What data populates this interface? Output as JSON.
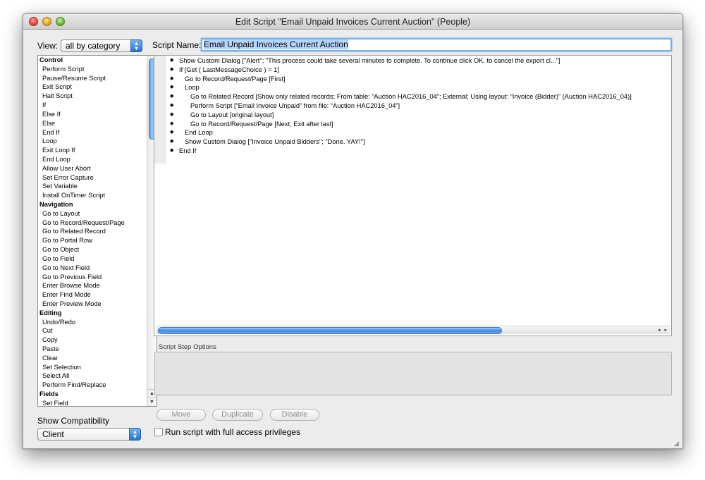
{
  "window": {
    "title": "Edit Script \"Email Unpaid Invoices Current Auction\" (People)"
  },
  "view": {
    "label": "View:",
    "selected": "all by category"
  },
  "script_name": {
    "label": "Script Name:",
    "value": "Email Unpaid Invoices Current Auction"
  },
  "steps": [
    {
      "label": "Control",
      "category": true
    },
    {
      "label": "Perform Script"
    },
    {
      "label": "Pause/Resume Script"
    },
    {
      "label": "Exit Script"
    },
    {
      "label": "Halt Script"
    },
    {
      "label": "If"
    },
    {
      "label": "Else If"
    },
    {
      "label": "Else"
    },
    {
      "label": "End If"
    },
    {
      "label": "Loop"
    },
    {
      "label": "Exit Loop If"
    },
    {
      "label": "End Loop"
    },
    {
      "label": "Allow User Abort"
    },
    {
      "label": "Set Error Capture"
    },
    {
      "label": "Set Variable"
    },
    {
      "label": "Install OnTimer Script"
    },
    {
      "label": "Navigation",
      "category": true
    },
    {
      "label": "Go to Layout"
    },
    {
      "label": "Go to Record/Request/Page"
    },
    {
      "label": "Go to Related Record"
    },
    {
      "label": "Go to Portal Row"
    },
    {
      "label": "Go to Object"
    },
    {
      "label": "Go to Field"
    },
    {
      "label": "Go to Next Field"
    },
    {
      "label": "Go to Previous Field"
    },
    {
      "label": "Enter Browse Mode"
    },
    {
      "label": "Enter Find Mode"
    },
    {
      "label": "Enter Preview Mode"
    },
    {
      "label": "Editing",
      "category": true
    },
    {
      "label": "Undo/Redo"
    },
    {
      "label": "Cut"
    },
    {
      "label": "Copy"
    },
    {
      "label": "Paste"
    },
    {
      "label": "Clear"
    },
    {
      "label": "Set Selection"
    },
    {
      "label": "Select All"
    },
    {
      "label": "Perform Find/Replace"
    },
    {
      "label": "Fields",
      "category": true
    },
    {
      "label": "Set Field"
    }
  ],
  "script_lines": [
    {
      "indent": 0,
      "text": "Show Custom Dialog [\"Alert\"; \"This process could take several minutes to complete. To continue click OK, to cancel the export cl...\"]"
    },
    {
      "indent": 0,
      "text": "If [Get ( LastMessageChoice )  = 1]"
    },
    {
      "indent": 1,
      "text": "Go to Record/Request/Page [First]"
    },
    {
      "indent": 1,
      "text": "Loop"
    },
    {
      "indent": 2,
      "text": "Go to Related Record [Show only related records; From table: “Auction HAC2016_04”; External; Using layout: “Invoice (Bidder)” (Auction HAC2016_04)]"
    },
    {
      "indent": 2,
      "text": "Perform Script [“Email Invoice Unpaid” from file: “Auction HAC2016_04”]"
    },
    {
      "indent": 2,
      "text": "Go to Layout [original layout]"
    },
    {
      "indent": 2,
      "text": "Go to Record/Request/Page [Next; Exit after last]"
    },
    {
      "indent": 1,
      "text": "End Loop"
    },
    {
      "indent": 1,
      "text": "Show Custom Dialog [\"Invoice Unpaid Bidders\"; \"Done. YAY!\"]"
    },
    {
      "indent": 0,
      "text": "End If"
    }
  ],
  "options": {
    "label": "Script Step Options"
  },
  "buttons": {
    "move": "Move",
    "duplicate": "Duplicate",
    "disable": "Disable"
  },
  "full_access": {
    "label": "Run script with full access privileges",
    "checked": false
  },
  "compatibility": {
    "label": "Show Compatibility",
    "selected": "Client"
  }
}
